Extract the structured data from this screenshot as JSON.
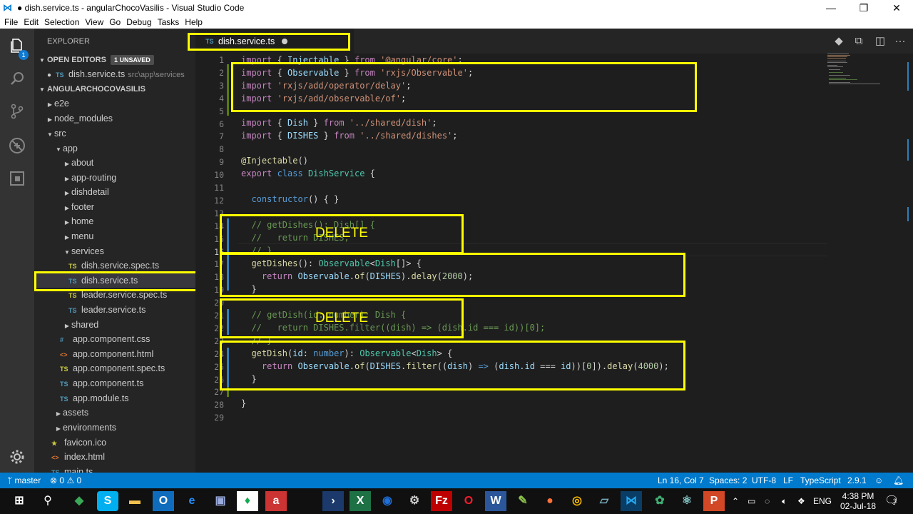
{
  "window": {
    "title": "● dish.service.ts - angularChocoVasilis - Visual Studio Code",
    "minimize": "—",
    "maximize": "❐",
    "close": "✕"
  },
  "menu": [
    "File",
    "Edit",
    "Selection",
    "View",
    "Go",
    "Debug",
    "Tasks",
    "Help"
  ],
  "activity": {
    "badge": "1"
  },
  "sidebar": {
    "title": "EXPLORER",
    "open_editors": {
      "label": "OPEN EDITORS",
      "badge": "1 UNSAVED",
      "file": "dish.service.ts",
      "path": "src\\app\\services"
    },
    "project": "ANGULARCHOCOVASILIS",
    "tree": [
      {
        "label": "e2e"
      },
      {
        "label": "node_modules"
      },
      {
        "label": "src"
      },
      {
        "label": "app"
      },
      {
        "label": "about"
      },
      {
        "label": "app-routing"
      },
      {
        "label": "dishdetail"
      },
      {
        "label": "footer"
      },
      {
        "label": "home"
      },
      {
        "label": "menu"
      },
      {
        "label": "services"
      },
      {
        "label": "dish.service.spec.ts"
      },
      {
        "label": "dish.service.ts"
      },
      {
        "label": "leader.service.spec.ts"
      },
      {
        "label": "leader.service.ts"
      },
      {
        "label": "shared"
      },
      {
        "label": "app.component.css"
      },
      {
        "label": "app.component.html"
      },
      {
        "label": "app.component.spec.ts"
      },
      {
        "label": "app.component.ts"
      },
      {
        "label": "app.module.ts"
      },
      {
        "label": "assets"
      },
      {
        "label": "environments"
      },
      {
        "label": "favicon.ico"
      },
      {
        "label": "index.html"
      },
      {
        "label": "main.ts"
      }
    ]
  },
  "tab": {
    "label": "dish.service.ts",
    "icon": "TS"
  },
  "editor": {
    "line_numbers": [
      "1",
      "2",
      "3",
      "4",
      "5",
      "6",
      "7",
      "8",
      "9",
      "10",
      "11",
      "12",
      "13",
      "14",
      "15",
      "16",
      "17",
      "18",
      "19",
      "20",
      "21",
      "22",
      "23",
      "24",
      "25",
      "26",
      "27",
      "28",
      "29"
    ],
    "annotations": {
      "delete_1": "DELETE",
      "delete_2": "DELETE"
    }
  },
  "status": {
    "branch": "master",
    "errors": "0",
    "warnings": "0",
    "position": "Ln 16, Col 7",
    "spaces": "Spaces: 2",
    "encoding": "UTF-8",
    "eol": "LF",
    "language": "TypeScript",
    "version": "2.9.1",
    "notifications": "1"
  },
  "taskbar": {
    "lang": "ENG",
    "time": "4:38 PM",
    "date": "02-Jul-18",
    "notif": "3"
  }
}
